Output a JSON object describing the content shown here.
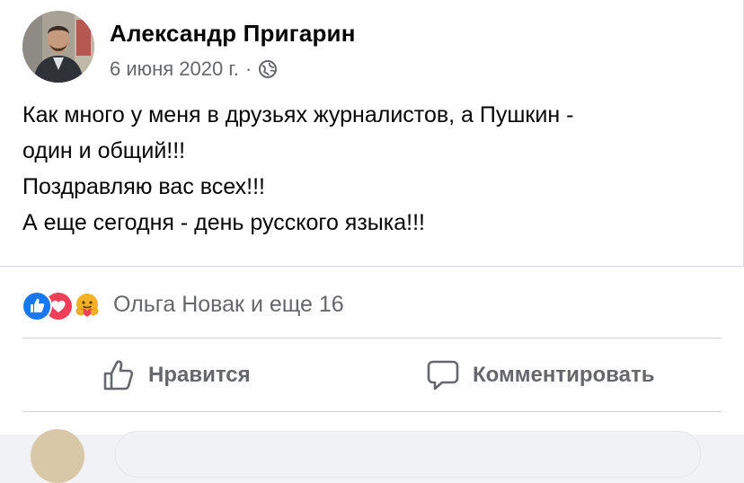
{
  "post": {
    "author": "Александр Пригарин",
    "date": "6 июня 2020 г.",
    "separator": "·",
    "audience_icon": "globe-icon",
    "text_lines": [
      "Как много у меня в друзьях журналистов,  а Пушкин -",
      "один и общий!!!",
      "Поздравляю вас всех!!!",
      "А еще сегодня - день русского языка!!!"
    ]
  },
  "reactions": {
    "icons": [
      "like-reaction-icon",
      "love-reaction-icon",
      "care-reaction-icon"
    ],
    "summary": "Ольга Новак и еще 16"
  },
  "actions": {
    "like_label": "Нравится",
    "comment_label": "Комментировать"
  },
  "colors": {
    "like_blue": "#1877f2",
    "love_red": "#f33e58",
    "care_yellow": "#f7b125",
    "secondary_text": "#65676b",
    "primary_text": "#050505"
  }
}
